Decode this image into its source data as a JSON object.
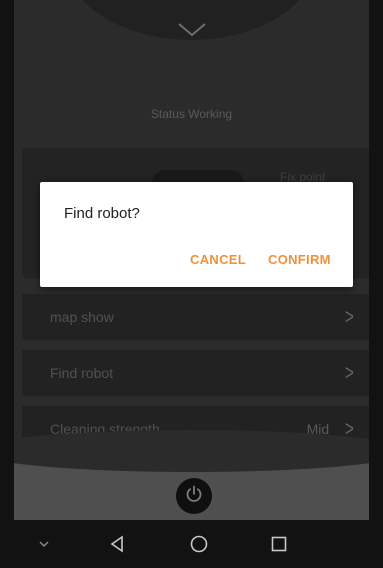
{
  "header": {
    "status_text": "Status Working"
  },
  "mode_card": {
    "label": "Fix point"
  },
  "menu": [
    {
      "label": "map show",
      "value": "",
      "arrow": ">"
    },
    {
      "label": "Find robot",
      "value": "",
      "arrow": ">"
    },
    {
      "label": "Cleaning strength",
      "value": "Mid",
      "arrow": ">"
    }
  ],
  "dialog": {
    "title": "Find robot?",
    "cancel_label": "CANCEL",
    "confirm_label": "CONFIRM"
  },
  "icons": {
    "chevron": "chevron-down-icon",
    "power": "power-icon",
    "nav": [
      "hide-keyboard-icon",
      "back-icon",
      "home-icon",
      "recents-icon"
    ]
  },
  "colors": {
    "accent": "#f0913a",
    "background": "#4a4a4a",
    "dialog_bg": "#ffffff"
  }
}
